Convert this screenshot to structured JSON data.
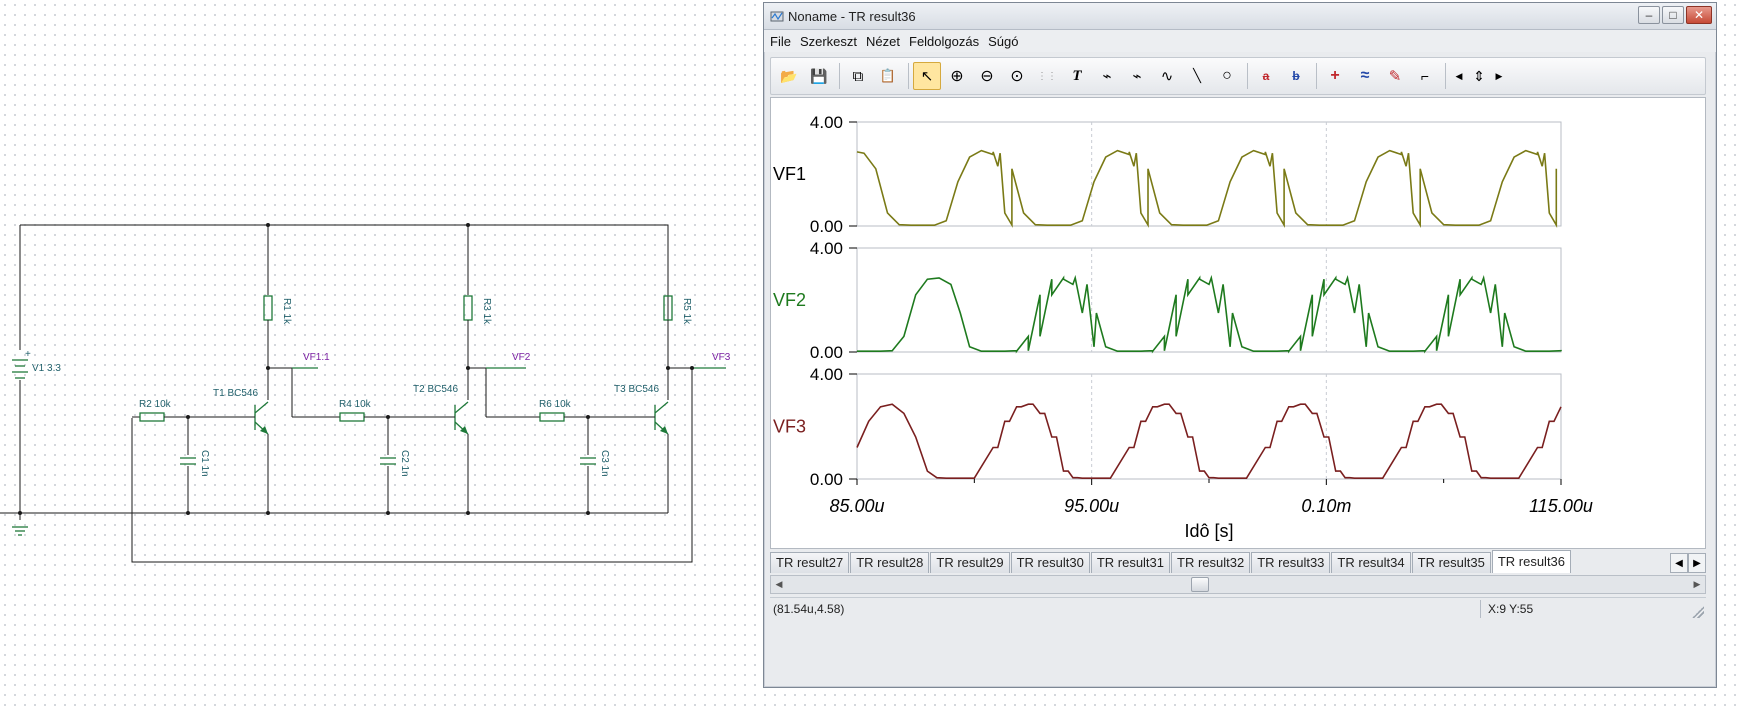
{
  "schematic": {
    "source": "V1 3.3",
    "source_plus": "+",
    "resistors": [
      "R1 1k",
      "R3 1k",
      "R5 1k",
      "R2 10k",
      "R4 10k",
      "R6 10k"
    ],
    "capacitors": [
      "C1 1n",
      "C2 1n",
      "C3 1n"
    ],
    "transistors": [
      "T1 BC546",
      "T2 BC546",
      "T3 BC546"
    ],
    "probes": [
      "VF1:1",
      "VF2",
      "VF3"
    ]
  },
  "window": {
    "title": "Noname - TR result36",
    "buttons": {
      "minimize": "–",
      "maximize": "□",
      "close": "✕"
    }
  },
  "menu": [
    "File",
    "Szerkeszt",
    "Nézet",
    "Feldolgozás",
    "Súgó"
  ],
  "toolbar": [
    {
      "name": "open-icon",
      "glyph": "📂"
    },
    {
      "name": "save-icon",
      "glyph": "💾"
    },
    {
      "name": "copy-icon",
      "glyph": "⧉"
    },
    {
      "name": "paste-icon",
      "glyph": "📋"
    },
    {
      "name": "pointer-icon",
      "glyph": "↖"
    },
    {
      "name": "zoom-in-icon",
      "glyph": "⊕"
    },
    {
      "name": "zoom-out-icon",
      "glyph": "⊖"
    },
    {
      "name": "zoom-100-icon",
      "glyph": "⊙"
    },
    {
      "name": "grid-icon",
      "glyph": "⋮⋮"
    },
    {
      "name": "text-icon",
      "glyph": "T"
    },
    {
      "name": "marker-icon",
      "glyph": "⌁"
    },
    {
      "name": "marker2-icon",
      "glyph": "⌁"
    },
    {
      "name": "function-icon",
      "glyph": "∿"
    },
    {
      "name": "line-icon",
      "glyph": "╲"
    },
    {
      "name": "circle-icon",
      "glyph": "○"
    },
    {
      "name": "cursor-a-icon",
      "glyph": "a"
    },
    {
      "name": "cursor-b-icon",
      "glyph": "b"
    },
    {
      "name": "add-curve-icon",
      "glyph": "+"
    },
    {
      "name": "add-curves-icon",
      "glyph": "≈"
    },
    {
      "name": "wand-icon",
      "glyph": "✎"
    },
    {
      "name": "flag-icon",
      "glyph": "⌐"
    },
    {
      "name": "arrow-left-icon",
      "glyph": "◀"
    },
    {
      "name": "arrow-updown-icon",
      "glyph": "⇕"
    },
    {
      "name": "arrow-right-icon",
      "glyph": "▶"
    }
  ],
  "chart_data": {
    "type": "line",
    "xlabel": "Idô [s]",
    "x_ticks": [
      "85.00u",
      "95.00u",
      "0.10m",
      "115.00u"
    ],
    "x_tick_values_us": [
      85,
      95,
      105,
      115
    ],
    "xlim_us": [
      85,
      115
    ],
    "ylim": [
      0,
      4
    ],
    "y_ticks": [
      "0.00",
      "4.00"
    ],
    "grid": true,
    "series": [
      {
        "name": "VF1",
        "color": "#7a7a16",
        "x_us": [
          85.0,
          85.3,
          85.8,
          86.3,
          86.8,
          87.3,
          88.3,
          88.8,
          89.3,
          89.8,
          90.3,
          90.8,
          91.0,
          91.3,
          91.6
        ],
        "values": [
          2.85,
          2.8,
          2.2,
          0.5,
          0.05,
          0.03,
          0.03,
          0.2,
          1.7,
          2.65,
          2.9,
          2.75,
          2.3,
          0.5,
          0.04
        ]
      },
      {
        "name": "VF2",
        "color": "#1e7a1e",
        "x_us": [
          85.0,
          86.0,
          86.5,
          87.0,
          87.5,
          88.0,
          88.5,
          89.0,
          89.4,
          89.8,
          90.3,
          91.3,
          91.8,
          92.3,
          92.8,
          93.3,
          93.8,
          94.2,
          94.6,
          95.1
        ],
        "values": [
          0.03,
          0.03,
          0.05,
          0.6,
          2.2,
          2.8,
          2.85,
          2.6,
          1.5,
          0.2,
          0.03,
          0.03,
          0.05,
          0.6,
          2.2,
          2.8,
          2.85,
          2.6,
          1.5,
          0.2
        ]
      },
      {
        "name": "VF3",
        "color": "#7a1f1f",
        "x_us": [
          85.0,
          85.5,
          86.0,
          86.5,
          87.0,
          87.5,
          88.0,
          88.4,
          88.8,
          89.3,
          90.0,
          91.0,
          91.5,
          92.0,
          92.5,
          93.0,
          93.5,
          94.0,
          94.4
        ],
        "values": [
          1.2,
          2.2,
          2.75,
          2.85,
          2.5,
          1.6,
          0.3,
          0.05,
          0.03,
          0.03,
          0.03,
          1.2,
          2.2,
          2.75,
          2.85,
          2.5,
          1.6,
          0.3,
          0.05
        ]
      }
    ],
    "period_us": 5.8
  },
  "tabs": [
    "TR result27",
    "TR result28",
    "TR result29",
    "TR result30",
    "TR result31",
    "TR result32",
    "TR result33",
    "TR result34",
    "TR result35",
    "TR result36"
  ],
  "active_tab": "TR result36",
  "tab_scroll": {
    "left": "◀",
    "right": "▶"
  },
  "scroll_arrows": {
    "left": "◀",
    "right": "▶"
  },
  "status": {
    "coords": "(81.54u,4.58)",
    "cursor": "X:9  Y:55"
  }
}
